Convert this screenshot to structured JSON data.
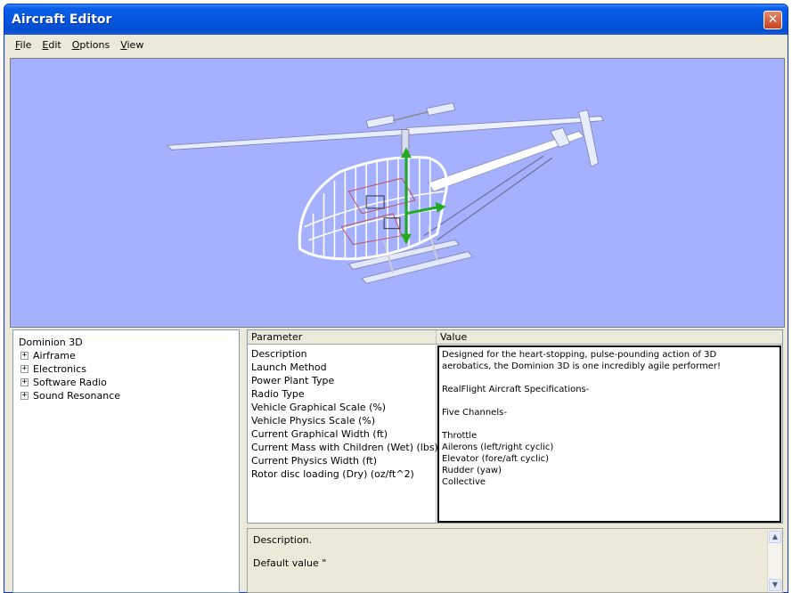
{
  "window": {
    "title": "Aircraft Editor",
    "close_glyph": "✕"
  },
  "menu": {
    "items": [
      {
        "label": "File",
        "underline": "F",
        "rest": "ile"
      },
      {
        "label": "Edit",
        "underline": "E",
        "rest": "dit"
      },
      {
        "label": "Options",
        "underline": "O",
        "rest": "ptions"
      },
      {
        "label": "View",
        "underline": "V",
        "rest": "iew"
      }
    ]
  },
  "viewport": {
    "background": "#a5b1ff",
    "subject": "helicopter-wireframe"
  },
  "tree": {
    "root": "Dominion 3D",
    "nodes": [
      {
        "label": "Airframe"
      },
      {
        "label": "Electronics"
      },
      {
        "label": "Software Radio"
      },
      {
        "label": "Sound Resonance"
      }
    ]
  },
  "grid": {
    "header_param": "Parameter",
    "header_value": "Value",
    "parameters": [
      "Description",
      "Launch Method",
      "Power Plant Type",
      "Radio Type",
      "Vehicle Graphical Scale (%)",
      "Vehicle Physics Scale (%)",
      "Current Graphical Width (ft)",
      "Current Mass with Children (Wet) (lbs)",
      "Current Physics Width (ft)",
      "Rotor disc loading (Dry) (oz/ft^2)"
    ],
    "value_lines": [
      "Designed for the heart-stopping, pulse-pounding action of 3D",
      "aerobatics, the Dominion 3D is one incredibly agile performer!",
      "",
      "RealFlight Aircraft Specifications-",
      "",
      "Five Channels-",
      "",
      "Throttle",
      "Ailerons (left/right cyclic)",
      "Elevator (fore/aft cyclic)",
      "Rudder (yaw)",
      "Collective"
    ]
  },
  "description": {
    "title": "Description.",
    "default_value": "Default value \""
  }
}
